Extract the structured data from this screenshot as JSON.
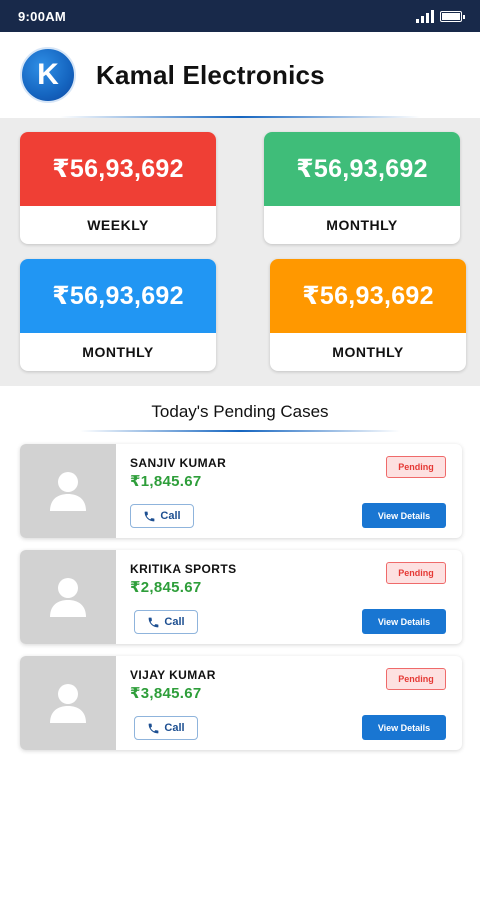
{
  "status_bar": {
    "time": "9:00AM",
    "icons": [
      "signal-icon",
      "battery-icon"
    ]
  },
  "header": {
    "logo_letter": "K",
    "title": "Kamal Electronics"
  },
  "stats": [
    {
      "value": "₹56,93,692",
      "label": "WEEKLY",
      "color": "#ef3f35"
    },
    {
      "value": "₹56,93,692",
      "label": "MONTHLY",
      "color": "#3fbd79"
    },
    {
      "value": "₹56,93,692",
      "label": "MONTHLY",
      "color": "#2196f3"
    },
    {
      "value": "₹56,93,692",
      "label": "MONTHLY",
      "color": "#ff9800"
    }
  ],
  "pending": {
    "title": "Today's Pending Cases",
    "items": [
      {
        "name": "SANJIV KUMAR",
        "amount": "₹1,845.67",
        "status": "Pending",
        "call_label": "Call",
        "details_label": "View Details"
      },
      {
        "name": "KRITIKA SPORTS",
        "amount": "₹2,845.67",
        "status": "Pending",
        "call_label": "Call",
        "details_label": "View Details"
      },
      {
        "name": "VIJAY KUMAR",
        "amount": "₹3,845.67",
        "status": "Pending",
        "call_label": "Call",
        "details_label": "View Details"
      }
    ]
  },
  "colors": {
    "status_bar": "#18294a",
    "brand_blue": "#1565c0",
    "amount_green": "#2e9e3a",
    "pending_red": "#e53935"
  }
}
